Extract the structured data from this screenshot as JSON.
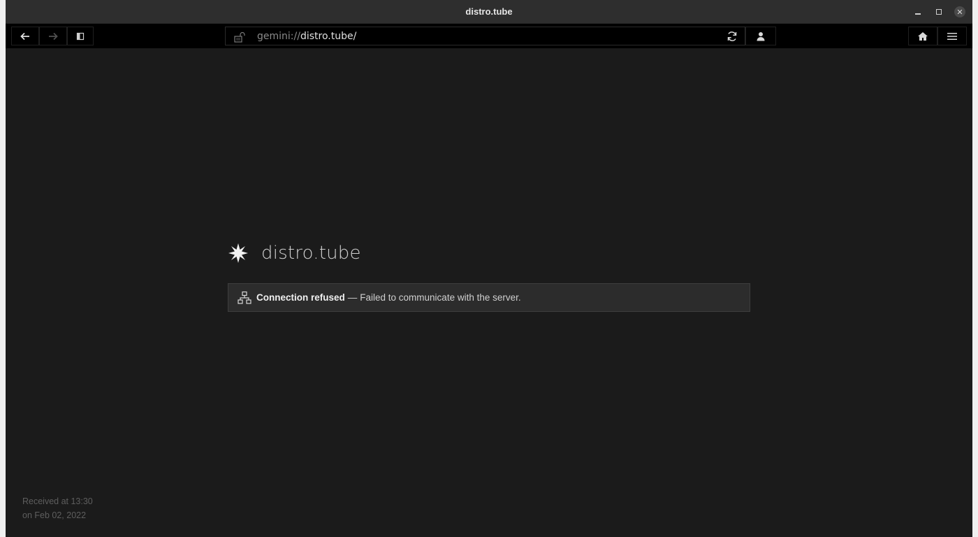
{
  "window": {
    "title": "distro.tube"
  },
  "toolbar": {
    "url_scheme": "gemini://",
    "url_host": "distro.tube/",
    "back_icon": "arrow-left-icon",
    "forward_icon": "arrow-right-icon",
    "sidebar_icon": "sidebar-icon",
    "reload_icon": "reload-icon",
    "identity_icon": "person-icon",
    "home_icon": "home-icon",
    "menu_icon": "hamburger-menu-icon"
  },
  "page": {
    "site_name": "distro.tube",
    "site_icon": "sparkle-icon",
    "error": {
      "icon": "network-icon",
      "title": "Connection refused",
      "separator": "—",
      "message": "Failed to communicate with the server."
    },
    "received_line1": "Received at 13:30",
    "received_line2": "on Feb 02, 2022"
  },
  "colors": {
    "background": "#1b1b1b",
    "toolbar": "#000000",
    "banner": "#2c2c2c",
    "text": "#cfcfcf"
  }
}
